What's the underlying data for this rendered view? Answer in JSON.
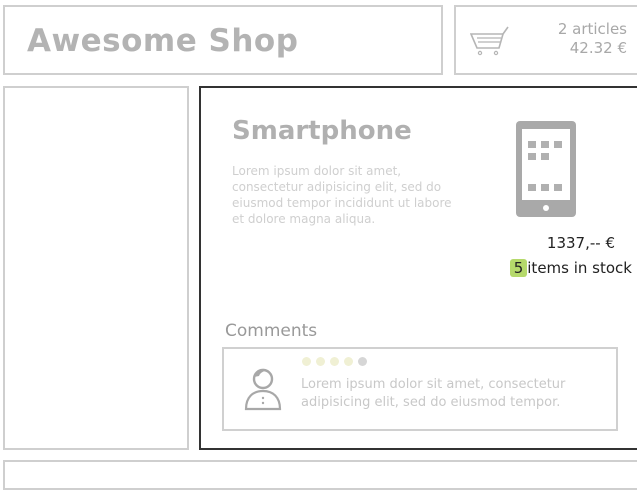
{
  "header": {
    "brand": "Awesome Shop"
  },
  "cart": {
    "icon": "shopping-cart-icon",
    "articles": "2 articles",
    "total": "42.32 €"
  },
  "product": {
    "title": "Smartphone",
    "description": "Lorem ipsum dolor sit amet, consectetur adipisicing elit, sed do eiusmod tempor incididunt ut labore et dolore magna aliqua.",
    "icon": "smartphone-icon",
    "price": "1337,-- €",
    "stock_count": "5",
    "stock_label": "items in stock",
    "stock_badge_color": "#b5d96b"
  },
  "comments": {
    "heading": "Comments",
    "items": [
      {
        "avatar": "user-avatar-icon",
        "rating": 4,
        "rating_max": 5,
        "text": "Lorem ipsum dolor sit amet, consectetur adipisicing elit, sed do eiusmod tempor."
      }
    ]
  }
}
